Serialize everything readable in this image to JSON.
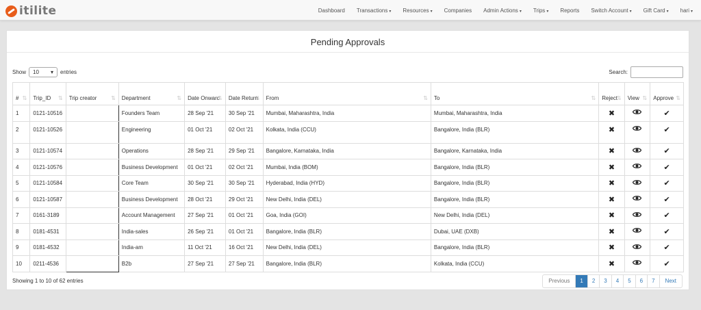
{
  "brand": {
    "name": "itilite"
  },
  "nav": [
    {
      "label": "Dashboard",
      "dropdown": false
    },
    {
      "label": "Transactions",
      "dropdown": true
    },
    {
      "label": "Resources",
      "dropdown": true
    },
    {
      "label": "Companies",
      "dropdown": false
    },
    {
      "label": "Admin Actions",
      "dropdown": true
    },
    {
      "label": "Trips",
      "dropdown": true
    },
    {
      "label": "Reports",
      "dropdown": false
    },
    {
      "label": "Switch Account",
      "dropdown": true
    },
    {
      "label": "Gift Card",
      "dropdown": true
    },
    {
      "label": "hari",
      "dropdown": true
    }
  ],
  "page_title": "Pending Approvals",
  "show": {
    "prefix": "Show",
    "value": "10",
    "suffix": "entries"
  },
  "search": {
    "label": "Search:",
    "value": ""
  },
  "table": {
    "headers": [
      "#",
      "Trip_ID",
      "Trip creator",
      "Department",
      "Date Onward",
      "Date Return",
      "From",
      "To",
      "Reject",
      "View",
      "Approve"
    ],
    "rows": [
      [
        "1",
        "0121-10516",
        "",
        "Founders Team",
        "28 Sep '21",
        "30 Sep '21",
        "Mumbai, Maharashtra, India",
        "Mumbai, Maharashtra, India"
      ],
      [
        "2",
        "0121-10526",
        "",
        "Engineering",
        "01 Oct '21",
        "02 Oct '21",
        "Kolkata, India (CCU)",
        "Bangalore, India (BLR)"
      ],
      [
        "3",
        "0121-10574",
        "",
        "Operations",
        "28 Sep '21",
        "29 Sep '21",
        "Bangalore, Karnataka, India",
        "Bangalore, Karnataka, India"
      ],
      [
        "4",
        "0121-10576",
        "",
        "Business Development",
        "01 Oct '21",
        "02 Oct '21",
        "Mumbai, India (BOM)",
        "Bangalore, India (BLR)"
      ],
      [
        "5",
        "0121-10584",
        "",
        "Core Team",
        "30 Sep '21",
        "30 Sep '21",
        "Hyderabad, India (HYD)",
        "Bangalore, India (BLR)"
      ],
      [
        "6",
        "0121-10587",
        "",
        "Business Development",
        "28 Oct '21",
        "29 Oct '21",
        "New Delhi, India (DEL)",
        "Bangalore, India (BLR)"
      ],
      [
        "7",
        "0161-3189",
        "",
        "Account Management",
        "27 Sep '21",
        "01 Oct '21",
        "Goa, India (GOI)",
        "New Delhi, India (DEL)"
      ],
      [
        "8",
        "0181-4531",
        "",
        "India-sales",
        "26 Sep '21",
        "01 Oct '21",
        "Bangalore, India (BLR)",
        "Dubai, UAE (DXB)"
      ],
      [
        "9",
        "0181-4532",
        "",
        "India-am",
        "11 Oct '21",
        "16 Oct '21",
        "New Delhi, India (DEL)",
        "Bangalore, India (BLR)"
      ],
      [
        "10",
        "0211-4536",
        "",
        "B2b",
        "27 Sep '21",
        "27 Sep '21",
        "Bangalore, India (BLR)",
        "Kolkata, India (CCU)"
      ]
    ]
  },
  "footer": {
    "info": "Showing 1 to 10 of 62 entries"
  },
  "pagination": {
    "previous": "Previous",
    "pages": [
      "1",
      "2",
      "3",
      "4",
      "5",
      "6",
      "7"
    ],
    "next": "Next",
    "current": "1"
  },
  "icons": {
    "reject": "times-icon",
    "view": "eye-icon",
    "approve": "check-icon"
  }
}
